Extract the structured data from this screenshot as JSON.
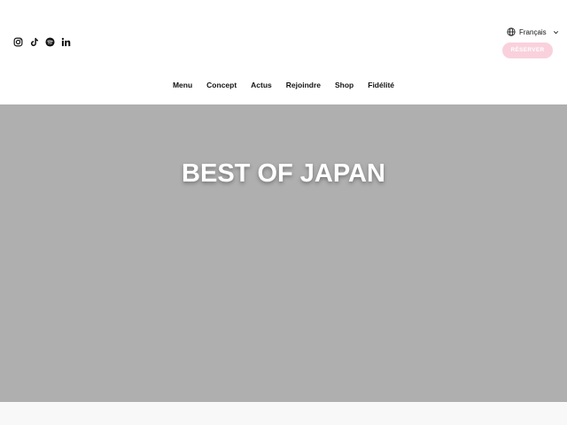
{
  "header": {
    "social": [
      {
        "icon": "instagram-icon"
      },
      {
        "icon": "tiktok-icon"
      },
      {
        "icon": "spotify-icon"
      },
      {
        "icon": "linkedin-icon"
      }
    ],
    "language": {
      "icon": "globe-icon",
      "label": "Français",
      "caret_icon": "chevron-down-icon"
    },
    "reserve_label": "RÉSERVER",
    "reserve_color": "#f9d1dc"
  },
  "nav": {
    "items": [
      {
        "label": "Menu"
      },
      {
        "label": "Concept"
      },
      {
        "label": "Actus"
      },
      {
        "label": "Rejoindre"
      },
      {
        "label": "Shop"
      },
      {
        "label": "Fidélité"
      }
    ]
  },
  "hero": {
    "title": "BEST OF JAPAN",
    "background_color": "#afafaf"
  }
}
